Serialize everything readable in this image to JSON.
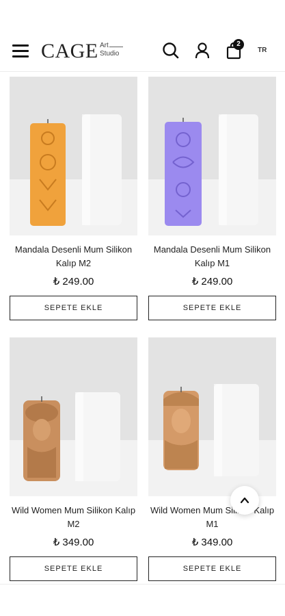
{
  "header": {
    "logo": {
      "main": "CAGE",
      "line1": "Art",
      "line2": "Studio"
    },
    "cart_count": "2",
    "language": "TR",
    "icons": {
      "menu": "hamburger-menu-icon",
      "search": "search-icon",
      "account": "user-icon",
      "cart": "shopping-bag-icon"
    }
  },
  "products": [
    {
      "title": "Mandala Desenli Mum Silikon Kalıp M2",
      "price": "₺ 249.00",
      "button": "SEPETE EKLE",
      "candle_color": "#f0a23c"
    },
    {
      "title": "Mandala Desenli Mum Silikon Kalıp M1",
      "price": "₺ 249.00",
      "button": "SEPETE EKLE",
      "candle_color": "#9b8aef"
    },
    {
      "title": "Wild Women Mum Silikon Kalıp M2",
      "price": "₺ 349.00",
      "button": "SEPETE EKLE",
      "candle_color": "#c98f5e"
    },
    {
      "title": "Wild Women Mum Silikon Kalıp M1",
      "price": "₺ 349.00",
      "button": "SEPETE EKLE",
      "candle_color": "#d49a68"
    }
  ],
  "scroll_top_icon": "chevron-up-icon"
}
